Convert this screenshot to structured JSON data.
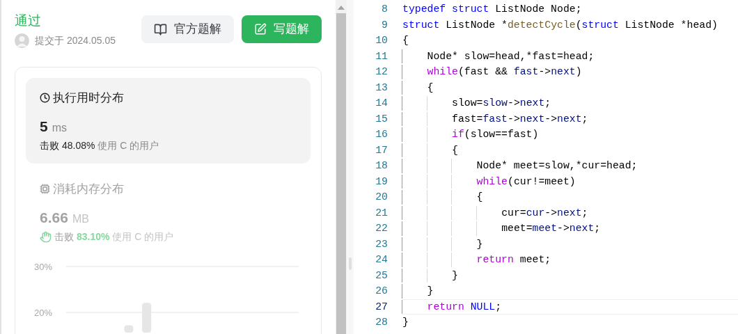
{
  "result": {
    "status": "通过",
    "submitted": "提交于 2024.05.05"
  },
  "buttons": [
    {
      "label": "官方题解",
      "kind": "secondary"
    },
    {
      "label": "写题解",
      "kind": "primary"
    }
  ],
  "stats": [
    {
      "kind": "runtime",
      "title": "执行用时分布",
      "value": "5",
      "unit": "ms",
      "beat_label": "击败",
      "percent": "48.08%",
      "suffix": "使用 C 的用户",
      "selected": true,
      "celebrate": false
    },
    {
      "kind": "memory",
      "title": "消耗内存分布",
      "value": "6.66",
      "unit": "MB",
      "beat_label": "击败",
      "percent": "83.10%",
      "suffix": "使用 C 的用户",
      "selected": false,
      "celebrate": true
    }
  ],
  "chart_data": {
    "type": "bar",
    "yticks": [
      {
        "value": 20,
        "label": "20%"
      },
      {
        "value": 30,
        "label": "30%"
      }
    ],
    "ylim": [
      15.6,
      30
    ],
    "values": [
      null,
      null,
      null,
      17.2,
      22.1,
      null,
      null,
      null,
      null,
      null,
      null,
      null,
      null
    ]
  },
  "code": [
    {
      "number": "8",
      "current": false,
      "tokens": [
        {
          "text": "typedef struct",
          "kind": "kw"
        },
        {
          "text": " ListNode Node;",
          "kind": "plain"
        }
      ]
    },
    {
      "number": "9",
      "current": false,
      "tokens": [
        {
          "text": "struct",
          "kind": "kw"
        },
        {
          "text": " ListNode *",
          "kind": "plain"
        },
        {
          "text": "detectCycle",
          "kind": "fn"
        },
        {
          "text": "(",
          "kind": "plain"
        },
        {
          "text": "struct",
          "kind": "kw"
        },
        {
          "text": " ListNode *head)",
          "kind": "plain"
        }
      ]
    },
    {
      "number": "10",
      "current": false,
      "tokens": [
        {
          "text": "{",
          "kind": "plain"
        }
      ]
    },
    {
      "number": "11",
      "current": false,
      "tokens": [
        {
          "text": "    Node* slow=head,*fast=head;",
          "kind": "plain"
        }
      ]
    },
    {
      "number": "12",
      "current": false,
      "tokens": [
        {
          "text": "    while",
          "kind": "ctl"
        },
        {
          "text": "(fast && ",
          "kind": "plain"
        },
        {
          "text": "fast",
          "kind": "var"
        },
        {
          "text": "->",
          "kind": "plain"
        },
        {
          "text": "next",
          "kind": "var"
        },
        {
          "text": ")",
          "kind": "plain"
        }
      ]
    },
    {
      "number": "13",
      "current": false,
      "tokens": [
        {
          "text": "    {",
          "kind": "plain"
        }
      ]
    },
    {
      "number": "14",
      "current": false,
      "tokens": [
        {
          "text": "        slow=",
          "kind": "plain"
        },
        {
          "text": "slow",
          "kind": "var"
        },
        {
          "text": "->",
          "kind": "plain"
        },
        {
          "text": "next",
          "kind": "var"
        },
        {
          "text": ";",
          "kind": "plain"
        }
      ]
    },
    {
      "number": "15",
      "current": false,
      "tokens": [
        {
          "text": "        fast=",
          "kind": "plain"
        },
        {
          "text": "fast",
          "kind": "var"
        },
        {
          "text": "->",
          "kind": "plain"
        },
        {
          "text": "next",
          "kind": "var"
        },
        {
          "text": "->",
          "kind": "plain"
        },
        {
          "text": "next",
          "kind": "var"
        },
        {
          "text": ";",
          "kind": "plain"
        }
      ]
    },
    {
      "number": "16",
      "current": false,
      "tokens": [
        {
          "text": "        if",
          "kind": "ctl"
        },
        {
          "text": "(slow==fast)",
          "kind": "plain"
        }
      ]
    },
    {
      "number": "17",
      "current": false,
      "tokens": [
        {
          "text": "        {",
          "kind": "plain"
        }
      ]
    },
    {
      "number": "18",
      "current": false,
      "tokens": [
        {
          "text": "            Node* meet=slow,*cur=head;",
          "kind": "plain"
        }
      ]
    },
    {
      "number": "19",
      "current": false,
      "tokens": [
        {
          "text": "            while",
          "kind": "ctl"
        },
        {
          "text": "(cur!=meet)",
          "kind": "plain"
        }
      ]
    },
    {
      "number": "20",
      "current": false,
      "tokens": [
        {
          "text": "            {",
          "kind": "plain"
        }
      ]
    },
    {
      "number": "21",
      "current": false,
      "tokens": [
        {
          "text": "                cur=",
          "kind": "plain"
        },
        {
          "text": "cur",
          "kind": "var"
        },
        {
          "text": "->",
          "kind": "plain"
        },
        {
          "text": "next",
          "kind": "var"
        },
        {
          "text": ";",
          "kind": "plain"
        }
      ]
    },
    {
      "number": "22",
      "current": false,
      "tokens": [
        {
          "text": "                meet=",
          "kind": "plain"
        },
        {
          "text": "meet",
          "kind": "var"
        },
        {
          "text": "->",
          "kind": "plain"
        },
        {
          "text": "next",
          "kind": "var"
        },
        {
          "text": ";",
          "kind": "plain"
        }
      ]
    },
    {
      "number": "23",
      "current": false,
      "tokens": [
        {
          "text": "            }",
          "kind": "plain"
        }
      ]
    },
    {
      "number": "24",
      "current": false,
      "tokens": [
        {
          "text": "            return",
          "kind": "ctl"
        },
        {
          "text": " meet;",
          "kind": "plain"
        }
      ]
    },
    {
      "number": "25",
      "current": false,
      "tokens": [
        {
          "text": "        }",
          "kind": "plain"
        }
      ]
    },
    {
      "number": "26",
      "current": false,
      "tokens": [
        {
          "text": "    }",
          "kind": "plain"
        }
      ]
    },
    {
      "number": "27",
      "current": true,
      "tokens": [
        {
          "text": "    return",
          "kind": "ctl"
        },
        {
          "text": " NULL",
          "kind": "kw"
        },
        {
          "text": ";",
          "kind": "plain"
        }
      ]
    },
    {
      "number": "28",
      "current": false,
      "tokens": [
        {
          "text": "}",
          "kind": "plain"
        }
      ]
    }
  ]
}
